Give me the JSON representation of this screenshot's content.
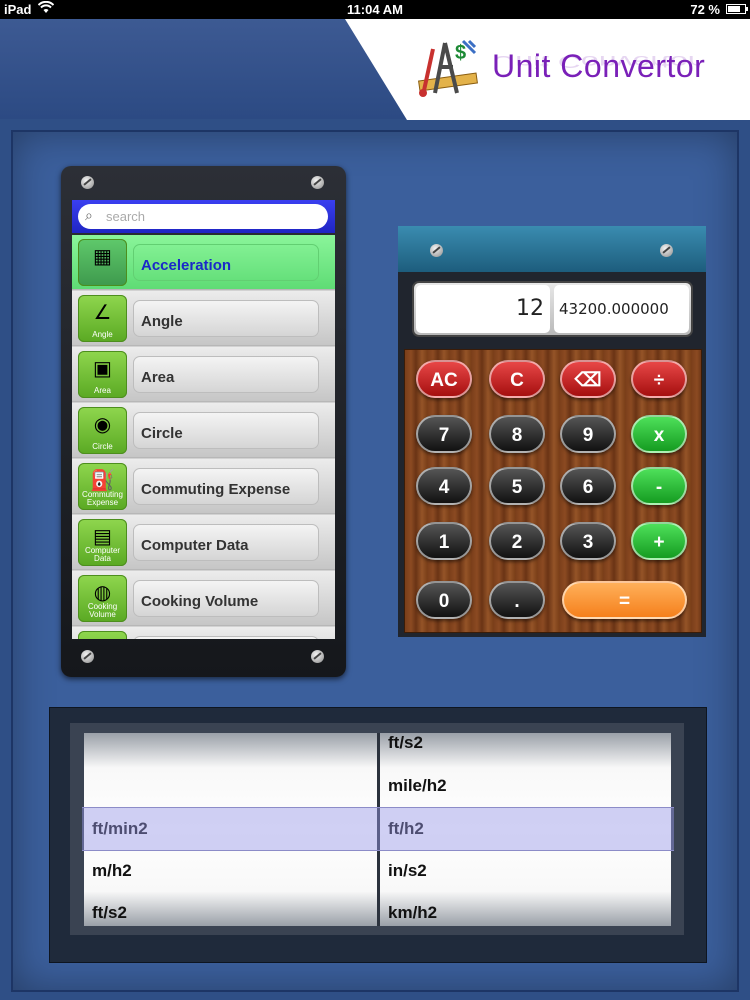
{
  "status_bar": {
    "device": "iPad",
    "wifi_icon": "wifi-icon",
    "time": "11:04 AM",
    "battery_text": "72 %",
    "battery_level": 0.72
  },
  "header": {
    "title": "Unit Convertor",
    "logo_icon": "tools-ruler-icon"
  },
  "search": {
    "placeholder": "search"
  },
  "categories": [
    {
      "label": "Acceleration",
      "caption": "",
      "icon": "acceleration-icon",
      "selected": true
    },
    {
      "label": "Angle",
      "caption": "Angle",
      "icon": "angle-icon",
      "selected": false
    },
    {
      "label": "Area",
      "caption": "Area",
      "icon": "area-icon",
      "selected": false
    },
    {
      "label": "Circle",
      "caption": "Circle",
      "icon": "circle-icon",
      "selected": false
    },
    {
      "label": "Commuting Expense",
      "caption": "Commuting Expense",
      "icon": "commuting-expense-icon",
      "selected": false
    },
    {
      "label": "Computer Data",
      "caption": "Computer Data",
      "icon": "computer-data-icon",
      "selected": false
    },
    {
      "label": "Cooking Volume",
      "caption": "Cooking Volume",
      "icon": "cooking-volume-icon",
      "selected": false
    }
  ],
  "calculator": {
    "input_value": "12",
    "result_value": "43200.000000",
    "keys": {
      "ac": "AC",
      "c": "C",
      "backspace": "⌫",
      "divide": "÷",
      "k7": "7",
      "k8": "8",
      "k9": "9",
      "multiply": "x",
      "k4": "4",
      "k5": "5",
      "k6": "6",
      "minus": "-",
      "k1": "1",
      "k2": "2",
      "k3": "3",
      "plus": "+",
      "k0": "0",
      "dot": ".",
      "equals": "="
    }
  },
  "picker": {
    "from_units": [
      "ft/min2",
      "m/h2",
      "ft/s2"
    ],
    "to_units": [
      "ft/s2",
      "mile/h2",
      "ft/h2",
      "in/s2",
      "km/h2"
    ],
    "selected_from": "ft/min2",
    "selected_to": "ft/h2"
  },
  "colors": {
    "background": "#2f4f86",
    "title": "#7a20b8",
    "selected_row": "#6fe882",
    "search_bar": "#2a30d8"
  }
}
